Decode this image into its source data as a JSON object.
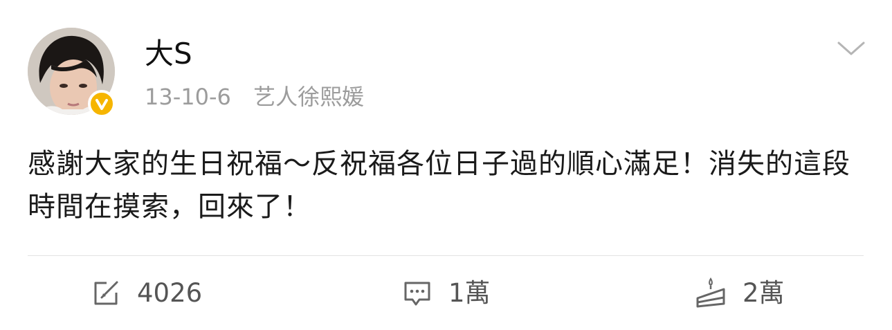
{
  "author": {
    "name": "大S",
    "avatar_icon": "avatar-photo",
    "verified_icon": "verified-badge-icon",
    "verified_color": "#f6b500"
  },
  "meta": {
    "date": "13-10-6",
    "source": "艺人徐熙媛"
  },
  "post": {
    "text": "感謝大家的生日祝福～反祝福各位日子過的順心滿足！消失的這段時間在摸索，回來了！"
  },
  "actions": {
    "repost": {
      "icon": "repost-icon",
      "count": "4026"
    },
    "comment": {
      "icon": "comment-icon",
      "count": "1萬"
    },
    "like": {
      "icon": "cake-like-icon",
      "count": "2萬"
    }
  },
  "menu_icon": "chevron-down-icon"
}
